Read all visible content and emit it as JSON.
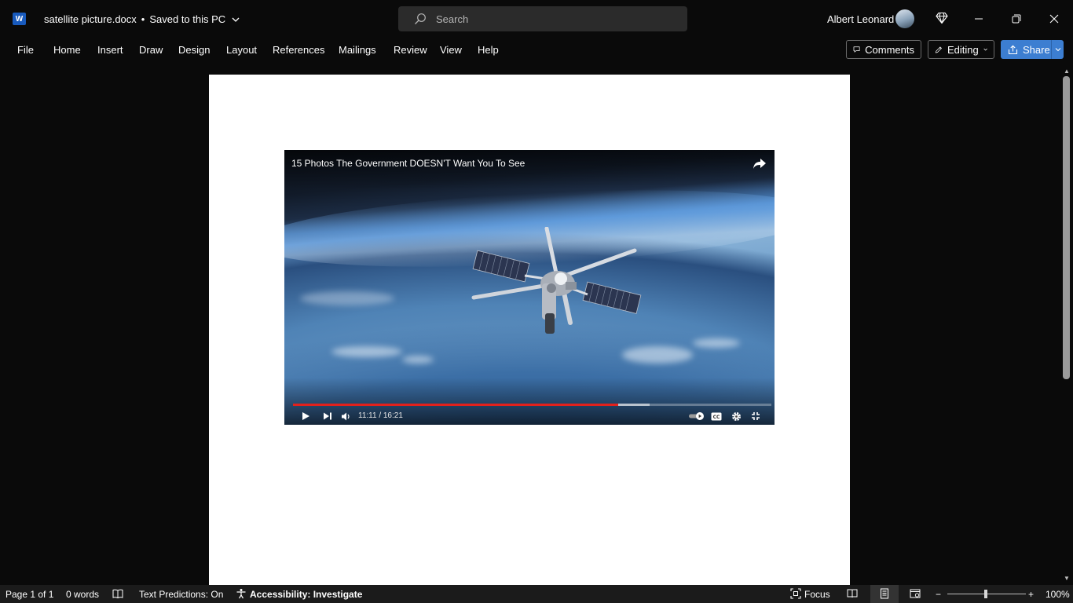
{
  "app": {
    "logo_letter": "W",
    "document_name": "satellite picture.docx",
    "separator": "•",
    "save_status": "Saved to this PC",
    "search_placeholder": "Search",
    "user_name": "Albert Leonard"
  },
  "menu": {
    "items": [
      "File",
      "Home",
      "Insert",
      "Draw",
      "Design",
      "Layout",
      "References",
      "Mailings",
      "Review",
      "View",
      "Help"
    ],
    "comments_label": "Comments",
    "editing_label": "Editing",
    "share_label": "Share"
  },
  "video": {
    "title": "15 Photos The Government DOESN'T Want You To See",
    "time_display": "11:11 / 16:21",
    "played_fraction": 0.68,
    "buffered_fraction": 0.745,
    "progress_color": "#e2211c"
  },
  "status": {
    "page_info": "Page 1 of 1",
    "word_count": "0 words",
    "text_predictions": "Text Predictions: On",
    "accessibility": "Accessibility: Investigate",
    "focus_label": "Focus",
    "zoom_minus": "−",
    "zoom_plus": "+",
    "zoom_level": "100%"
  },
  "colors": {
    "accent": "#3c7ed1",
    "word_brand": "#185abd",
    "background": "#0a0a0a"
  }
}
